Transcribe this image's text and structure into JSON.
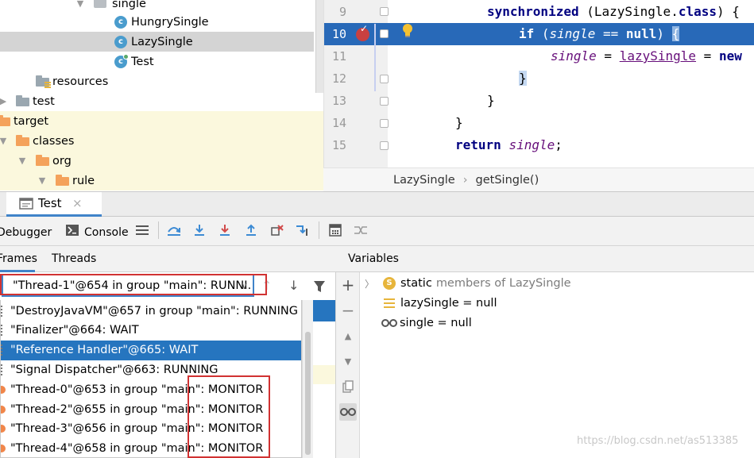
{
  "tree": {
    "items": [
      {
        "label": "single",
        "kind": "package"
      },
      {
        "label": "HungrySingle",
        "kind": "class"
      },
      {
        "label": "LazySingle",
        "kind": "class"
      },
      {
        "label": "Test",
        "kind": "class-run"
      },
      {
        "label": "resources",
        "kind": "folder-grey"
      },
      {
        "label": "test",
        "kind": "folder-grey"
      },
      {
        "label": "target",
        "kind": "folder-orange"
      },
      {
        "label": "classes",
        "kind": "folder-orange"
      },
      {
        "label": "org",
        "kind": "folder-orange"
      },
      {
        "label": "rule",
        "kind": "folder-orange"
      }
    ],
    "class_icon_letter": "c"
  },
  "editor": {
    "lines": [
      {
        "num": "9",
        "tokens": [
          {
            "t": "synchronized",
            "c": "kw"
          },
          {
            "t": " (LazySingle.",
            "c": ""
          },
          {
            "t": "class",
            "c": "kw"
          },
          {
            "t": ") {",
            "c": ""
          }
        ]
      },
      {
        "num": "10",
        "tokens": [
          {
            "t": "if",
            "c": "kw"
          },
          {
            "t": " (",
            "c": ""
          },
          {
            "t": "single",
            "c": "it"
          },
          {
            "t": " == ",
            "c": ""
          },
          {
            "t": "null",
            "c": "kw"
          },
          {
            "t": ") ",
            "c": ""
          },
          {
            "t": "{",
            "c": "brace"
          }
        ]
      },
      {
        "num": "11",
        "tokens": [
          {
            "t": "single",
            "c": "it"
          },
          {
            "t": " = ",
            "c": ""
          },
          {
            "t": "lazySingle",
            "c": "ul"
          },
          {
            "t": " = ",
            "c": ""
          },
          {
            "t": "new",
            "c": "kw"
          }
        ]
      },
      {
        "num": "12",
        "tokens": [
          {
            "t": "}",
            "c": "brace"
          }
        ]
      },
      {
        "num": "13",
        "tokens": [
          {
            "t": "}",
            "c": ""
          }
        ]
      },
      {
        "num": "14",
        "tokens": [
          {
            "t": "}",
            "c": ""
          }
        ]
      },
      {
        "num": "15",
        "tokens": [
          {
            "t": "return",
            "c": "kw"
          },
          {
            "t": " ",
            "c": ""
          },
          {
            "t": "single",
            "c": "it"
          },
          {
            "t": ";",
            "c": ""
          }
        ]
      }
    ],
    "breadcrumb": [
      "LazySingle",
      "getSingle()"
    ],
    "breadcrumb_sep": "›"
  },
  "run_tab": {
    "label": "Test",
    "close": "×"
  },
  "debug_toolbar": {
    "debugger_label": "Debugger",
    "console_label": "Console"
  },
  "frames": {
    "tab_frames": "Frames",
    "tab_threads": "Threads",
    "selected_thread": "\"Thread-1\"@654 in group \"main\": RUNNI…",
    "threads": [
      {
        "label": "\"DestroyJavaVM\"@657 in group \"main\": RUNNING",
        "state": "running",
        "selected": false
      },
      {
        "label": "\"Finalizer\"@664: WAIT",
        "state": "wait",
        "selected": false
      },
      {
        "label": "\"Reference Handler\"@665: WAIT",
        "state": "wait",
        "selected": true
      },
      {
        "label": "\"Signal Dispatcher\"@663: RUNNING",
        "state": "running",
        "selected": false
      },
      {
        "label": "\"Thread-0\"@653 in group \"main\": MONITOR",
        "state": "monitor",
        "selected": false
      },
      {
        "label": "\"Thread-2\"@655 in group \"main\": MONITOR",
        "state": "monitor",
        "selected": false
      },
      {
        "label": "\"Thread-3\"@656 in group \"main\": MONITOR",
        "state": "monitor",
        "selected": false
      },
      {
        "label": "\"Thread-4\"@658 in group \"main\": MONITOR",
        "state": "monitor",
        "selected": false
      }
    ]
  },
  "variables": {
    "tab_label": "Variables",
    "items": [
      {
        "icon": "S",
        "kind": "static",
        "name": "static",
        "value": "members of LazySingle"
      },
      {
        "icon": "field",
        "kind": "field",
        "name": "lazySingle",
        "value": " = null"
      },
      {
        "icon": "watch",
        "kind": "watch",
        "name": "single",
        "value": " = null"
      }
    ]
  },
  "watermark": "https://blog.csdn.net/as513385",
  "colors": {
    "accent": "#4083c9",
    "selection": "#2675bf",
    "highlight_line": "#2869b8",
    "annotation_red": "#d13232"
  }
}
